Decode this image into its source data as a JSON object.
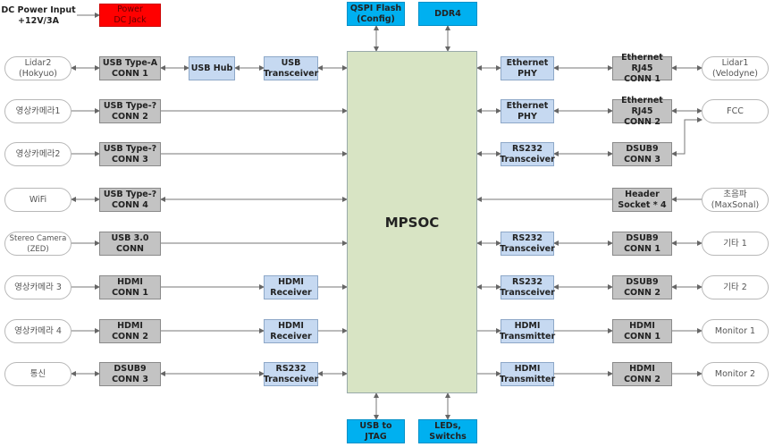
{
  "power": {
    "input": "DC Power Input\n+12V/3A",
    "jack": "Power\nDC Jack"
  },
  "mpsoc": "MPSOC",
  "top": [
    "QSPI Flash\n(Config)",
    "DDR4"
  ],
  "bottom": [
    "USB to JTAG",
    "LEDs,\nSwitchs"
  ],
  "left": {
    "nodes": [
      "Lidar2\n(Hokyuo)",
      "영상카메라1",
      "영상카메라2",
      "WiFi",
      "Stereo Camera\n(ZED)",
      "영상카메라 3",
      "영상카메라 4",
      "통신"
    ],
    "conns": [
      "USB Type-A\nCONN 1",
      "USB Type-?\nCONN 2",
      "USB Type-?\nCONN 3",
      "USB Type-?\nCONN 4",
      "USB 3.0\nCONN",
      "HDMI\nCONN 1",
      "HDMI\nCONN 2",
      "DSUB9\nCONN 3"
    ],
    "chips": {
      "hub": "USB Hub",
      "usb_trx": "USB\nTransceiver",
      "hdmi_rx1": "HDMI\nReceiver",
      "hdmi_rx2": "HDMI\nReceiver",
      "rs232": "RS232\nTransceiver"
    }
  },
  "right": {
    "chips": [
      "Ethernet\nPHY",
      "Ethernet\nPHY",
      "RS232\nTransceiver",
      "RS232\nTransceiver",
      "RS232\nTransceiver",
      "HDMI\nTransmitter",
      "HDMI\nTransmitter"
    ],
    "conns": [
      "Ethernet RJ45\nCONN 1",
      "Ethernet RJ45\nCONN 2",
      "DSUB9\nCONN 3",
      "Header\nSocket * 4",
      "DSUB9\nCONN 1",
      "DSUB9\nCONN 2",
      "HDMI\nCONN 1",
      "HDMI\nCONN 2"
    ],
    "nodes": [
      "Lidar1\n(Velodyne)",
      "FCC",
      "초음파\n(MaxSonal)",
      "기타 1",
      "기타 2",
      "Monitor 1",
      "Monitor 2"
    ]
  },
  "colors": {
    "connector": "#c3c3c3",
    "chip": "#c6d9f1",
    "mpsoc": "#d8e4c4",
    "memory": "#00b0f0",
    "power": "#ff0000"
  }
}
